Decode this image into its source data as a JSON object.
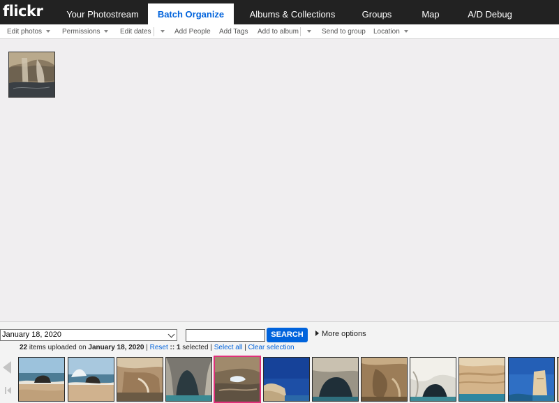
{
  "app": {
    "logo": "flickr"
  },
  "nav": {
    "tabs": [
      {
        "label": "Your Photostream",
        "active": false
      },
      {
        "label": "Batch Organize",
        "active": true
      },
      {
        "label": "Albums & Collections",
        "active": false
      },
      {
        "label": "Groups",
        "active": false
      },
      {
        "label": "Map",
        "active": false
      },
      {
        "label": "A/D Debug",
        "active": false
      }
    ]
  },
  "toolbar": {
    "edit_photos": "Edit photos",
    "permissions": "Permissions",
    "edit_dates": "Edit dates",
    "add_people": "Add People",
    "add_tags": "Add Tags",
    "add_to_album": "Add to album",
    "send_to_group": "Send to group",
    "location": "Location"
  },
  "tray": {
    "date_selected": "January 18, 2020",
    "search_value": "",
    "search_button": "SEARCH",
    "more_options": "More options",
    "info": {
      "count": "22",
      "items_text": " items uploaded on ",
      "date": "January 18, 2020",
      "sep1": " | ",
      "reset": "Reset",
      "sep2": " :: ",
      "selected_count": "1",
      "selected_text": " selected | ",
      "select_all": "Select all",
      "sep3": " | ",
      "clear_selection": "Clear selection"
    },
    "thumbnails": [
      {
        "subject": "beach-rock",
        "selected": false
      },
      {
        "subject": "beach-wave",
        "selected": false
      },
      {
        "subject": "cliff-rock",
        "selected": false
      },
      {
        "subject": "sea-cave",
        "selected": false
      },
      {
        "subject": "cave-opening",
        "selected": true
      },
      {
        "subject": "blue-sky-cliff",
        "selected": false
      },
      {
        "subject": "cave-arch",
        "selected": false
      },
      {
        "subject": "brown-cliff",
        "selected": false
      },
      {
        "subject": "white-arch",
        "selected": false
      },
      {
        "subject": "cliff-sea",
        "selected": false
      },
      {
        "subject": "blue-sky-tower",
        "selected": false
      },
      {
        "subject": "partial-cliff",
        "selected": false
      }
    ]
  },
  "colors": {
    "brand": "#0063dc",
    "selection": "#e0307a",
    "nav_bg": "#222222"
  }
}
